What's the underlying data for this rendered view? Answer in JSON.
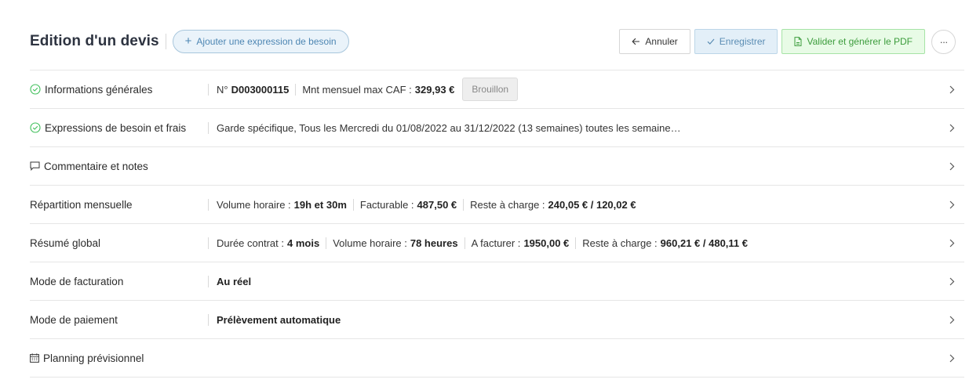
{
  "header": {
    "title": "Edition d'un devis",
    "add_need_label": "Ajouter une expression de besoin",
    "cancel_label": "Annuler",
    "save_label": "Enregistrer",
    "validate_label": "Valider et générer le PDF",
    "more_label": "···"
  },
  "sections": {
    "general": {
      "label": "Informations générales",
      "number_prefix": "N°",
      "number": "D003000115",
      "caf_prefix": "Mnt mensuel max CAF :",
      "caf_value": "329,93 €",
      "status": "Brouillon"
    },
    "needs": {
      "label": "Expressions de besoin et frais",
      "summary": "Garde spécifique, Tous les Mercredi du 01/08/2022 au 31/12/2022 (13 semaines) toutes les semaine…"
    },
    "comments": {
      "label": "Commentaire et notes"
    },
    "monthly": {
      "label": "Répartition mensuelle",
      "volume_prefix": "Volume horaire :",
      "volume_value": "19h et 30m",
      "billable_prefix": "Facturable :",
      "billable_value": "487,50 €",
      "remaining_prefix": "Reste à charge :",
      "remaining_value": "240,05 € / 120,02 €"
    },
    "global": {
      "label": "Résumé global",
      "duration_prefix": "Durée contrat :",
      "duration_value": "4 mois",
      "volume_prefix": "Volume horaire :",
      "volume_value": "78 heures",
      "tobill_prefix": "A facturer :",
      "tobill_value": "1950,00 €",
      "remaining_prefix": "Reste à charge :",
      "remaining_value": "960,21 € / 480,11 €"
    },
    "billing_mode": {
      "label": "Mode de facturation",
      "value": "Au réel"
    },
    "payment_mode": {
      "label": "Mode de paiement",
      "value": "Prélèvement automatique"
    },
    "planning": {
      "label": "Planning prévisionnel"
    }
  },
  "colors": {
    "check_green": "#3fbf5a",
    "save_blue": "#5b8db4",
    "validate_green": "#3c9c3c"
  }
}
